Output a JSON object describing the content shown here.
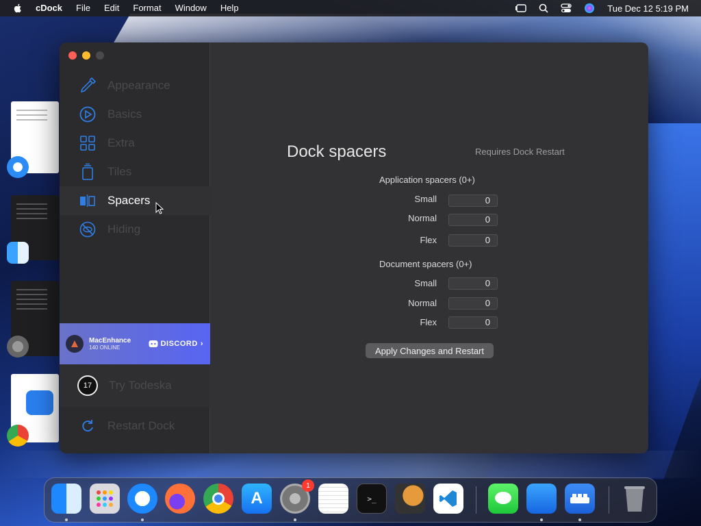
{
  "menubar": {
    "app_name": "cDock",
    "items": [
      "File",
      "Edit",
      "Format",
      "Window",
      "Help"
    ],
    "datetime": "Tue Dec 12  5:19 PM"
  },
  "sidebar": {
    "items": [
      {
        "label": "Appearance",
        "icon": "brush-icon"
      },
      {
        "label": "Basics",
        "icon": "play-circle-icon"
      },
      {
        "label": "Extra",
        "icon": "grid-icon"
      },
      {
        "label": "Tiles",
        "icon": "stack-icon"
      },
      {
        "label": "Spacers",
        "icon": "spacer-icon",
        "active": true
      },
      {
        "label": "Hiding",
        "icon": "eye-slash-icon"
      }
    ],
    "banner": {
      "name": "MacEnhance",
      "online": "140 ONLINE",
      "discord": "DISCORD"
    },
    "todeska": {
      "label": "Try Todeska",
      "icon_text": "17"
    },
    "restart": {
      "label": "Restart Dock"
    }
  },
  "content": {
    "title": "Dock spacers",
    "note": "Requires Dock Restart",
    "app_section": {
      "title": "Application spacers (0+)",
      "fields": [
        {
          "label": "Small",
          "value": "0"
        },
        {
          "label": "Normal",
          "value": "0"
        },
        {
          "label": "Flex",
          "value": "0"
        }
      ]
    },
    "doc_section": {
      "title": "Document spacers (0+)",
      "fields": [
        {
          "label": "Small",
          "value": "0"
        },
        {
          "label": "Normal",
          "value": "0"
        },
        {
          "label": "Flex",
          "value": "0"
        }
      ]
    },
    "apply_button": "Apply Changes and Restart"
  },
  "dock": {
    "apps": [
      "Finder",
      "Launchpad",
      "Safari",
      "Firefox",
      "Chrome",
      "App Store",
      "System Settings",
      "TextEdit",
      "Terminal",
      "GarageBand",
      "VS Code",
      "Messages",
      "Keynote",
      "cDock",
      "Trash"
    ],
    "settings_badge": "1"
  },
  "colors": {
    "accent": "#2f7fe6",
    "window_bg": "#323234",
    "sidebar_bg": "#2b2b2d",
    "discord": "#5865f2"
  }
}
